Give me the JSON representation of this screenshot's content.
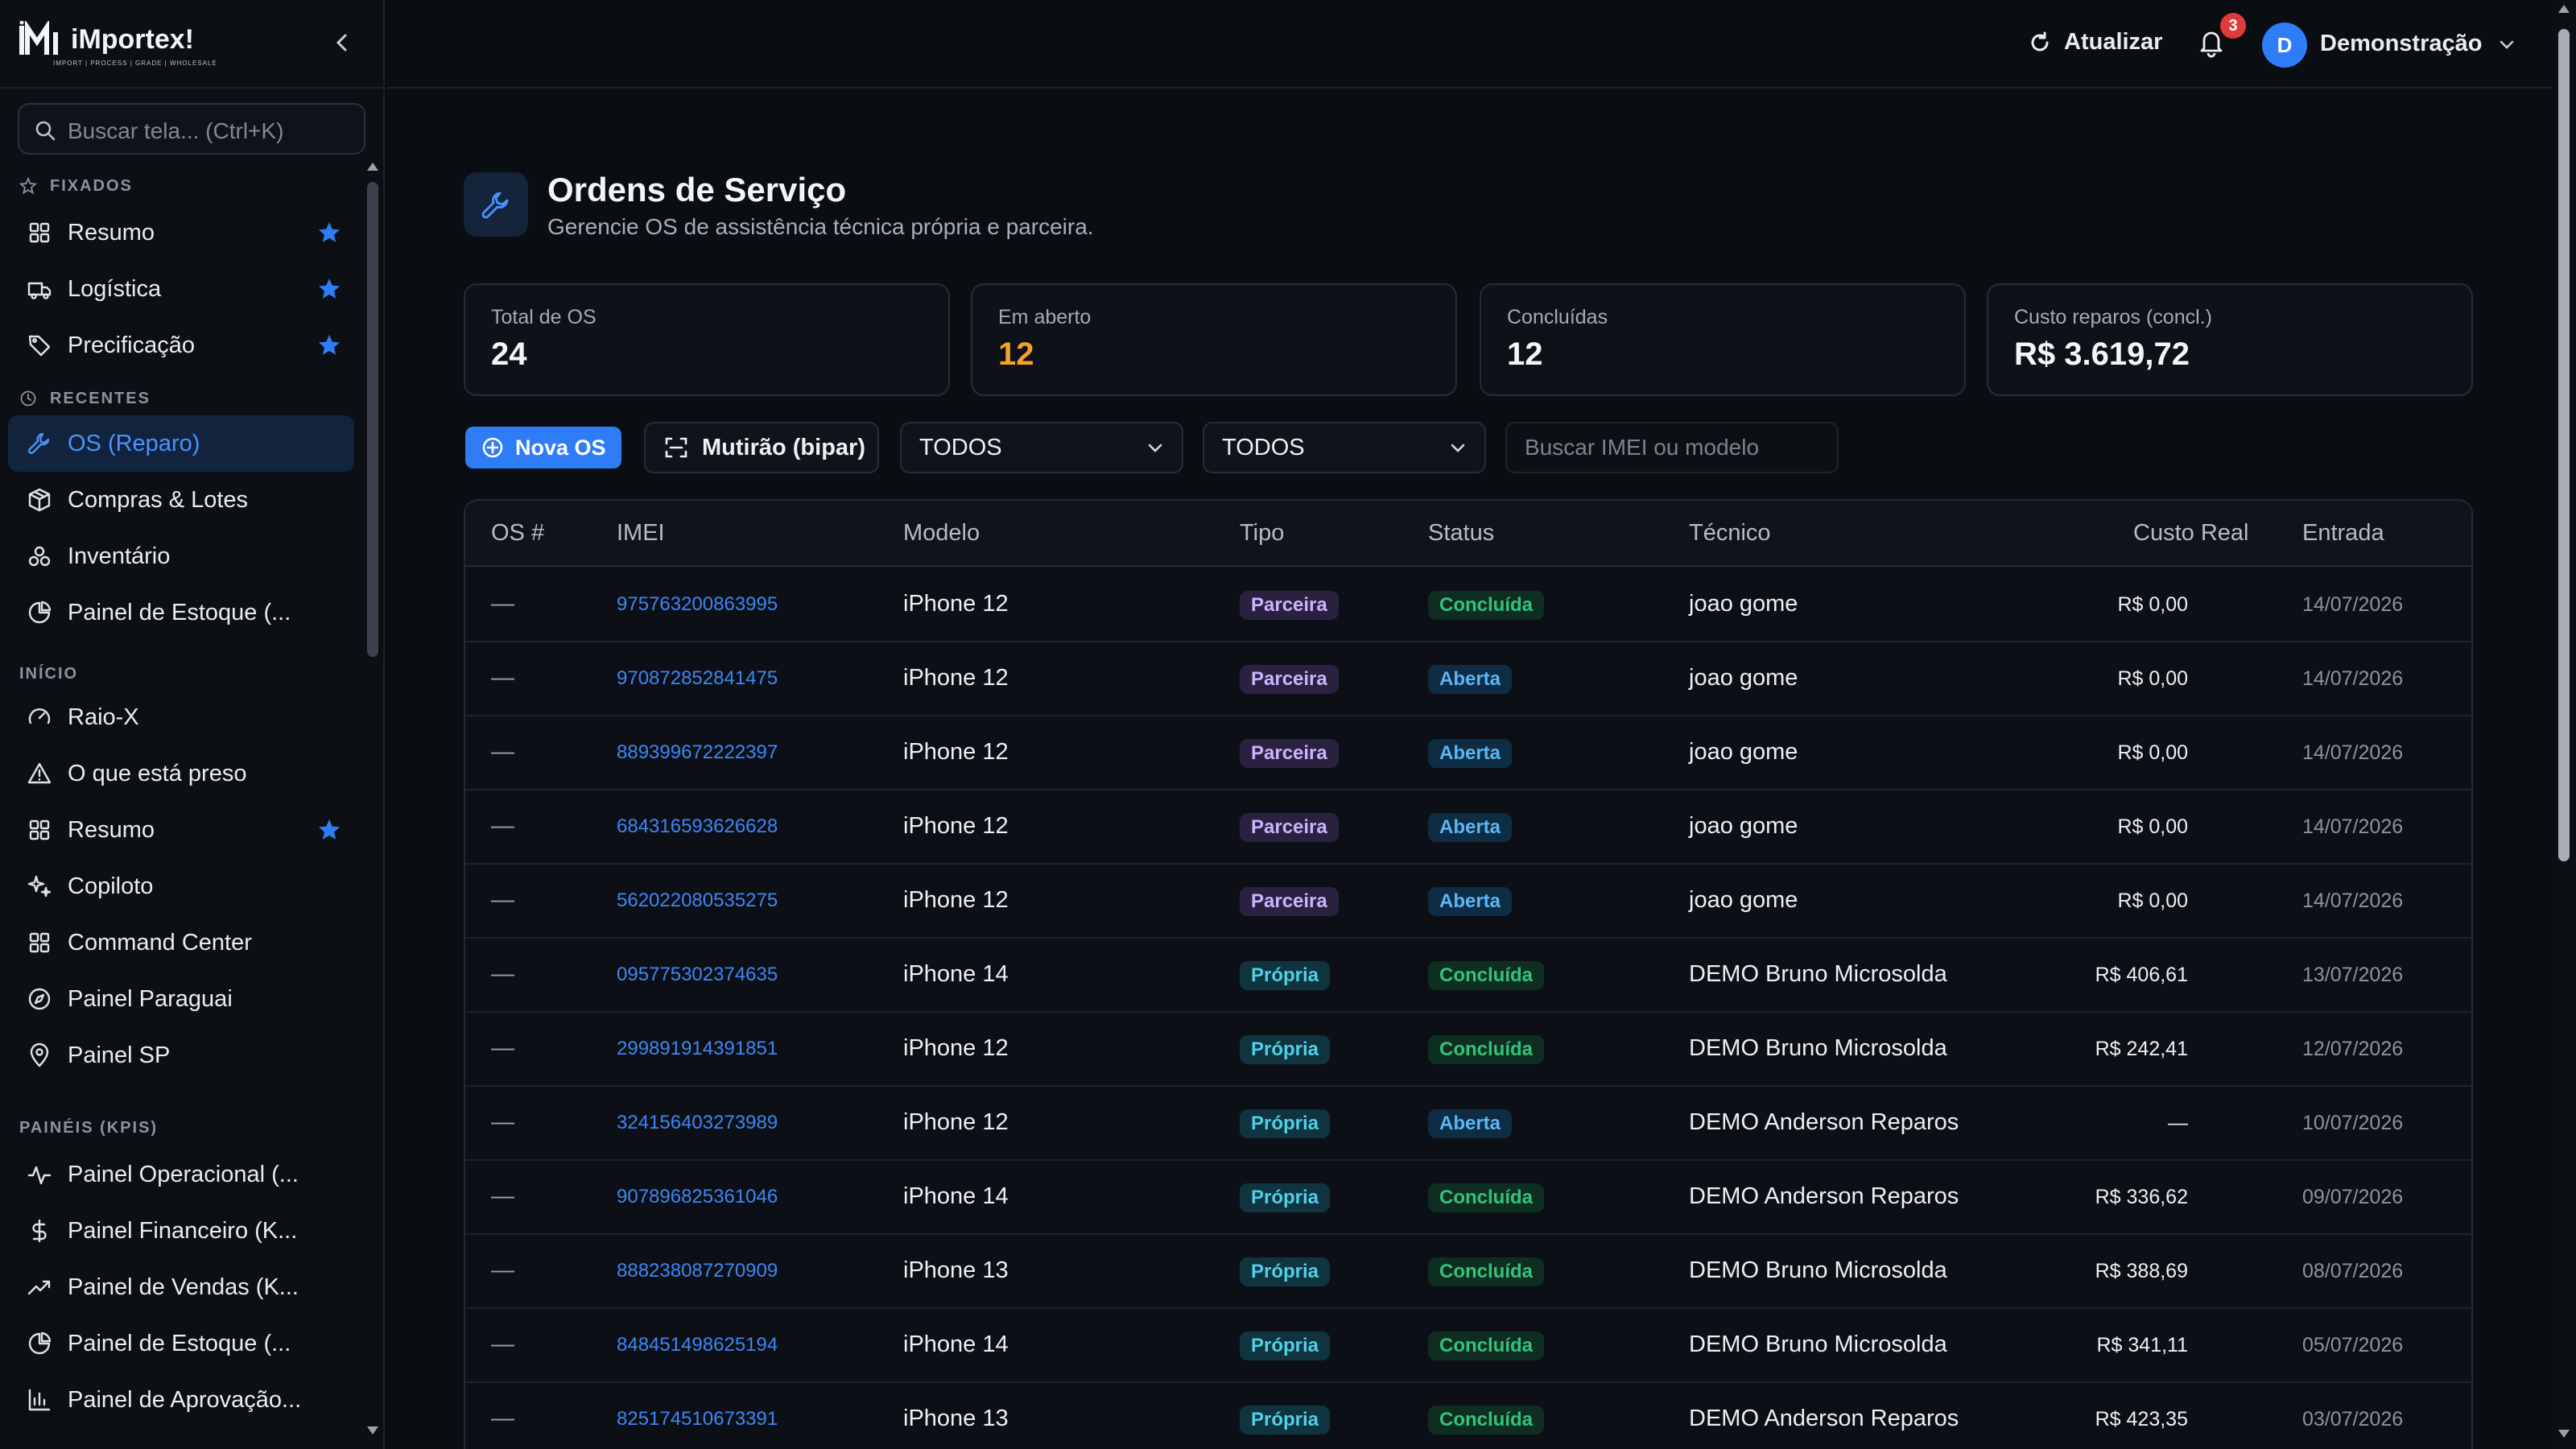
{
  "brand": {
    "name": "iMportex!",
    "tagline": "IMPORT | PROCESS | GRADE | WHOLESALE"
  },
  "search": {
    "placeholder": "Buscar tela... (Ctrl+K)"
  },
  "sections": {
    "pinned": "FIXADOS",
    "recent": "RECENTES",
    "start": "INÍCIO",
    "kpis": "PAINÉIS (KPIS)"
  },
  "nav": {
    "pinned": [
      {
        "label": "Resumo",
        "icon": "grid-icon",
        "starred": true
      },
      {
        "label": "Logística",
        "icon": "truck-icon",
        "starred": true
      },
      {
        "label": "Precificação",
        "icon": "tag-icon",
        "starred": true
      }
    ],
    "recent": [
      {
        "label": "OS (Reparo)",
        "icon": "wrench-icon",
        "active": true
      },
      {
        "label": "Compras & Lotes",
        "icon": "box-icon"
      },
      {
        "label": "Inventário",
        "icon": "boxes-icon"
      },
      {
        "label": "Painel de Estoque (...",
        "icon": "pie-icon"
      }
    ],
    "start": [
      {
        "label": "Raio-X",
        "icon": "gauge-icon"
      },
      {
        "label": "O que está preso",
        "icon": "alert-icon"
      },
      {
        "label": "Resumo",
        "icon": "grid-icon",
        "starred": true
      },
      {
        "label": "Copiloto",
        "icon": "sparkle-icon"
      },
      {
        "label": "Command Center",
        "icon": "grid-icon"
      },
      {
        "label": "Painel Paraguai",
        "icon": "compass-icon"
      },
      {
        "label": "Painel SP",
        "icon": "pin-icon"
      }
    ],
    "kpis": [
      {
        "label": "Painel Operacional (...",
        "icon": "pulse-icon"
      },
      {
        "label": "Painel Financeiro (K...",
        "icon": "dollar-icon"
      },
      {
        "label": "Painel de Vendas (K...",
        "icon": "trend-icon"
      },
      {
        "label": "Painel de Estoque (...",
        "icon": "pie-icon"
      },
      {
        "label": "Painel de Aprovação...",
        "icon": "bars-icon"
      }
    ]
  },
  "topbar": {
    "refresh_label": "Atualizar",
    "notifications_count": "3",
    "user_initial": "D",
    "user_name": "Demonstração"
  },
  "page": {
    "title": "Ordens de Serviço",
    "subtitle": "Gerencie OS de assistência técnica própria e parceira."
  },
  "stats": [
    {
      "label": "Total de OS",
      "value": "24"
    },
    {
      "label": "Em aberto",
      "value": "12",
      "accent": "#f5a22a"
    },
    {
      "label": "Concluídas",
      "value": "12"
    },
    {
      "label": "Custo reparos (concl.)",
      "value": "R$ 3.619,72"
    }
  ],
  "toolbar": {
    "new_label": "Nova OS",
    "bulk_label": "Mutirão (bipar)",
    "filter_type": "TODOS",
    "filter_status": "TODOS",
    "search_placeholder": "Buscar IMEI ou modelo"
  },
  "table": {
    "headers": [
      "OS #",
      "IMEI",
      "Modelo",
      "Tipo",
      "Status",
      "Técnico",
      "Custo Real",
      "Entrada"
    ],
    "rows": [
      {
        "os": "—",
        "imei": "975763200863995",
        "model": "iPhone 12",
        "type": "Parceira",
        "status": "Concluída",
        "tech": "joao gome",
        "cost": "R$ 0,00",
        "date": "14/07/2026"
      },
      {
        "os": "—",
        "imei": "970872852841475",
        "model": "iPhone 12",
        "type": "Parceira",
        "status": "Aberta",
        "tech": "joao gome",
        "cost": "R$ 0,00",
        "date": "14/07/2026"
      },
      {
        "os": "—",
        "imei": "889399672222397",
        "model": "iPhone 12",
        "type": "Parceira",
        "status": "Aberta",
        "tech": "joao gome",
        "cost": "R$ 0,00",
        "date": "14/07/2026"
      },
      {
        "os": "—",
        "imei": "684316593626628",
        "model": "iPhone 12",
        "type": "Parceira",
        "status": "Aberta",
        "tech": "joao gome",
        "cost": "R$ 0,00",
        "date": "14/07/2026"
      },
      {
        "os": "—",
        "imei": "562022080535275",
        "model": "iPhone 12",
        "type": "Parceira",
        "status": "Aberta",
        "tech": "joao gome",
        "cost": "R$ 0,00",
        "date": "14/07/2026"
      },
      {
        "os": "—",
        "imei": "095775302374635",
        "model": "iPhone 14",
        "type": "Própria",
        "status": "Concluída",
        "tech": "DEMO Bruno Microsolda",
        "cost": "R$ 406,61",
        "date": "13/07/2026"
      },
      {
        "os": "—",
        "imei": "299891914391851",
        "model": "iPhone 12",
        "type": "Própria",
        "status": "Concluída",
        "tech": "DEMO Bruno Microsolda",
        "cost": "R$ 242,41",
        "date": "12/07/2026"
      },
      {
        "os": "—",
        "imei": "324156403273989",
        "model": "iPhone 12",
        "type": "Própria",
        "status": "Aberta",
        "tech": "DEMO Anderson Reparos",
        "cost": "—",
        "date": "10/07/2026"
      },
      {
        "os": "—",
        "imei": "907896825361046",
        "model": "iPhone 14",
        "type": "Própria",
        "status": "Concluída",
        "tech": "DEMO Anderson Reparos",
        "cost": "R$ 336,62",
        "date": "09/07/2026"
      },
      {
        "os": "—",
        "imei": "888238087270909",
        "model": "iPhone 13",
        "type": "Própria",
        "status": "Concluída",
        "tech": "DEMO Bruno Microsolda",
        "cost": "R$ 388,69",
        "date": "08/07/2026"
      },
      {
        "os": "—",
        "imei": "848451498625194",
        "model": "iPhone 14",
        "type": "Própria",
        "status": "Concluída",
        "tech": "DEMO Bruno Microsolda",
        "cost": "R$ 341,11",
        "date": "05/07/2026"
      },
      {
        "os": "—",
        "imei": "825174510673391",
        "model": "iPhone 13",
        "type": "Própria",
        "status": "Concluída",
        "tech": "DEMO Anderson Reparos",
        "cost": "R$ 423,35",
        "date": "03/07/2026"
      }
    ]
  },
  "colors": {
    "accent": "#2e7cf6",
    "background": "#0a0d12",
    "open_orange": "#f5a22a"
  }
}
